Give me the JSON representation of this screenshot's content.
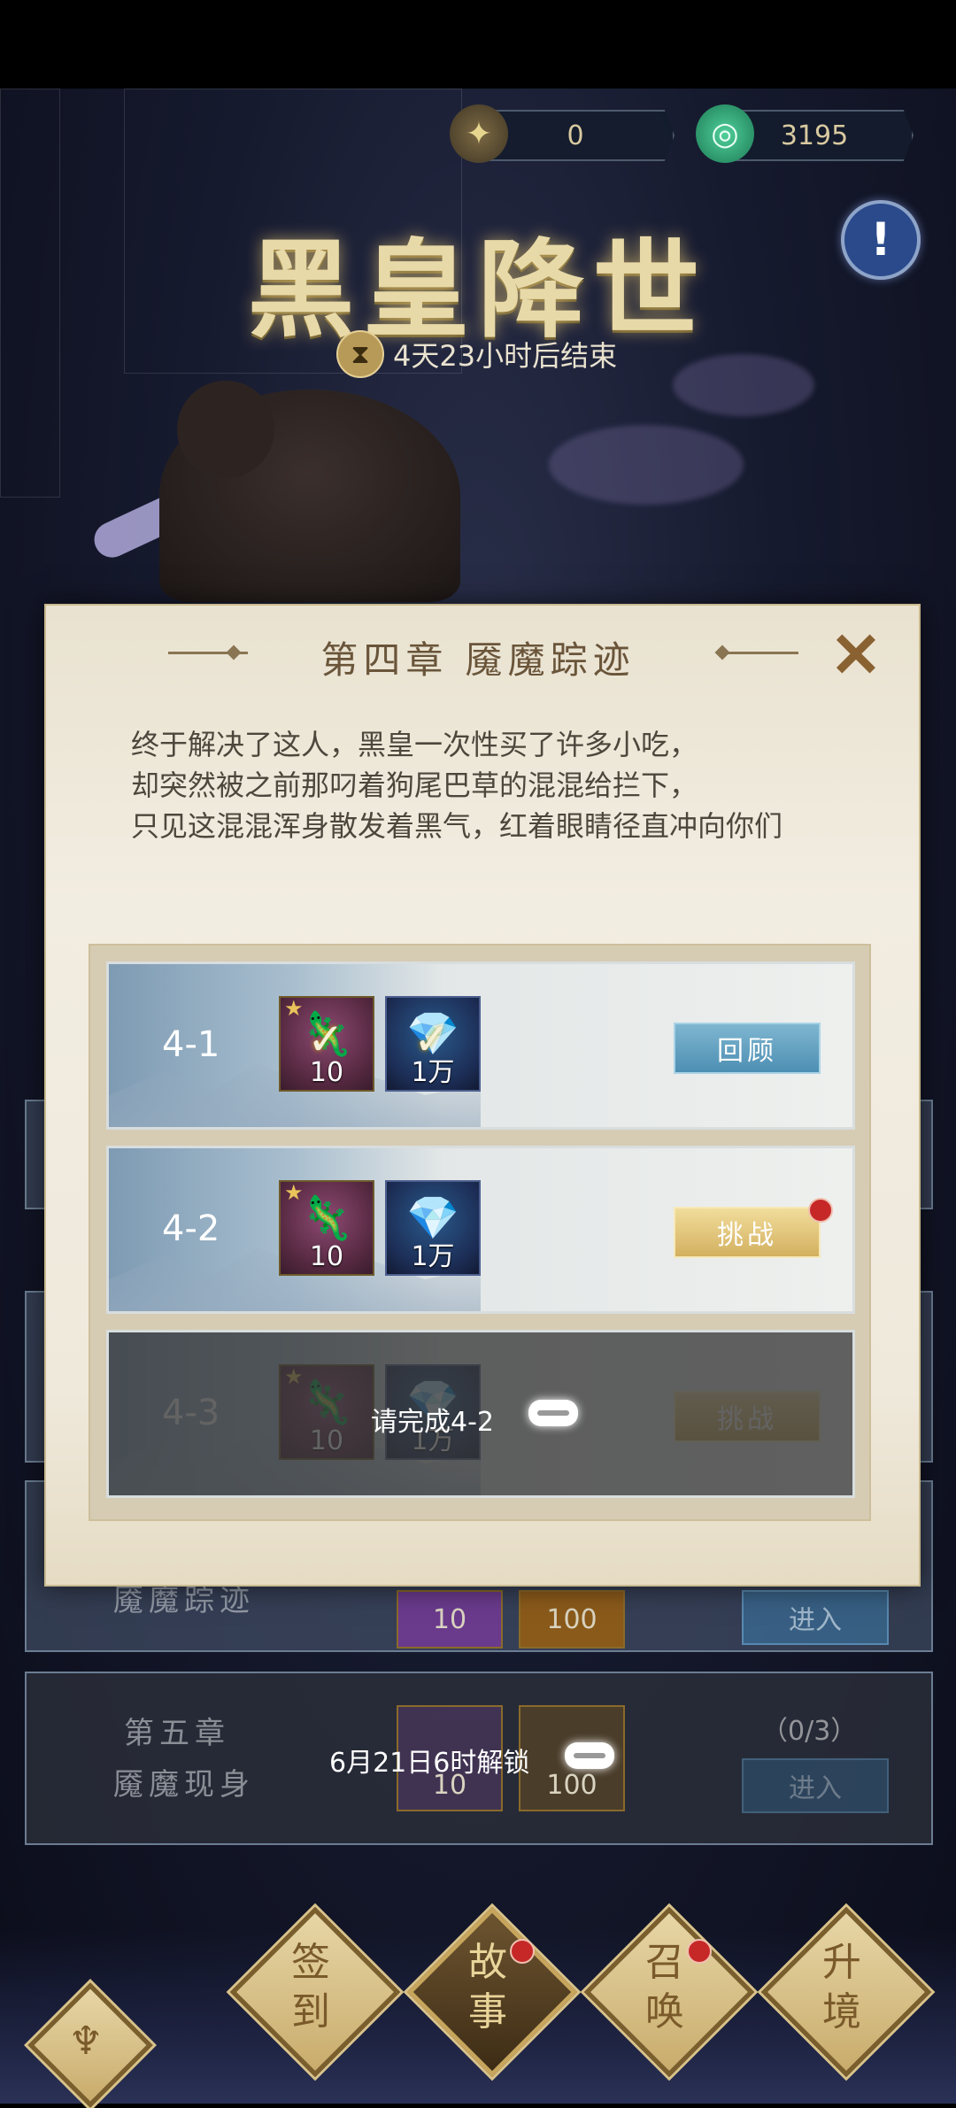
{
  "currency": {
    "tickets": "0",
    "jade": "3195"
  },
  "event": {
    "title": "黑皇降世",
    "timer": "4天23小时后结束"
  },
  "modal": {
    "title": "第四章  魇魔踪迹",
    "close_icon": "close-x-icon",
    "story": [
      "终于解决了这人，黑皇一次性买了许多小吃，",
      "却突然被之前那叼着狗尾巴草的混混给拦下，",
      "只见这混混浑身散发着黑气，红着眼睛径直冲向你们"
    ],
    "stages": [
      {
        "id": "4-1",
        "reward1_qty": "10",
        "reward2_qty": "1万",
        "claimed": true,
        "button": "回顾"
      },
      {
        "id": "4-2",
        "reward1_qty": "10",
        "reward2_qty": "1万",
        "claimed": false,
        "button": "挑战"
      },
      {
        "id": "4-3",
        "reward1_qty": "10",
        "reward2_qty": "1万",
        "claimed": false,
        "button": "挑战",
        "lock_text": "请完成4-2"
      }
    ]
  },
  "background_rows": {
    "chapter4_label": "魇魔踪迹",
    "chapter4_reward1": "10",
    "chapter4_reward2": "100",
    "chapter4_button": "进入",
    "chapter5_label_line1": "第五章",
    "chapter5_label_line2": "魇魔现身",
    "chapter5_reward1": "10",
    "chapter5_reward2": "100",
    "chapter5_progress": "（0/3）",
    "chapter5_button": "进入",
    "chapter5_lock_text": "6月21日6时解锁"
  },
  "bottom_nav": [
    {
      "label": "签到"
    },
    {
      "label": "故事"
    },
    {
      "label": "召唤"
    },
    {
      "label": "升境"
    }
  ],
  "colors": {
    "accent_gold": "#d3b060",
    "accent_blue": "#4d8fb3",
    "badge_red": "#c62828"
  }
}
